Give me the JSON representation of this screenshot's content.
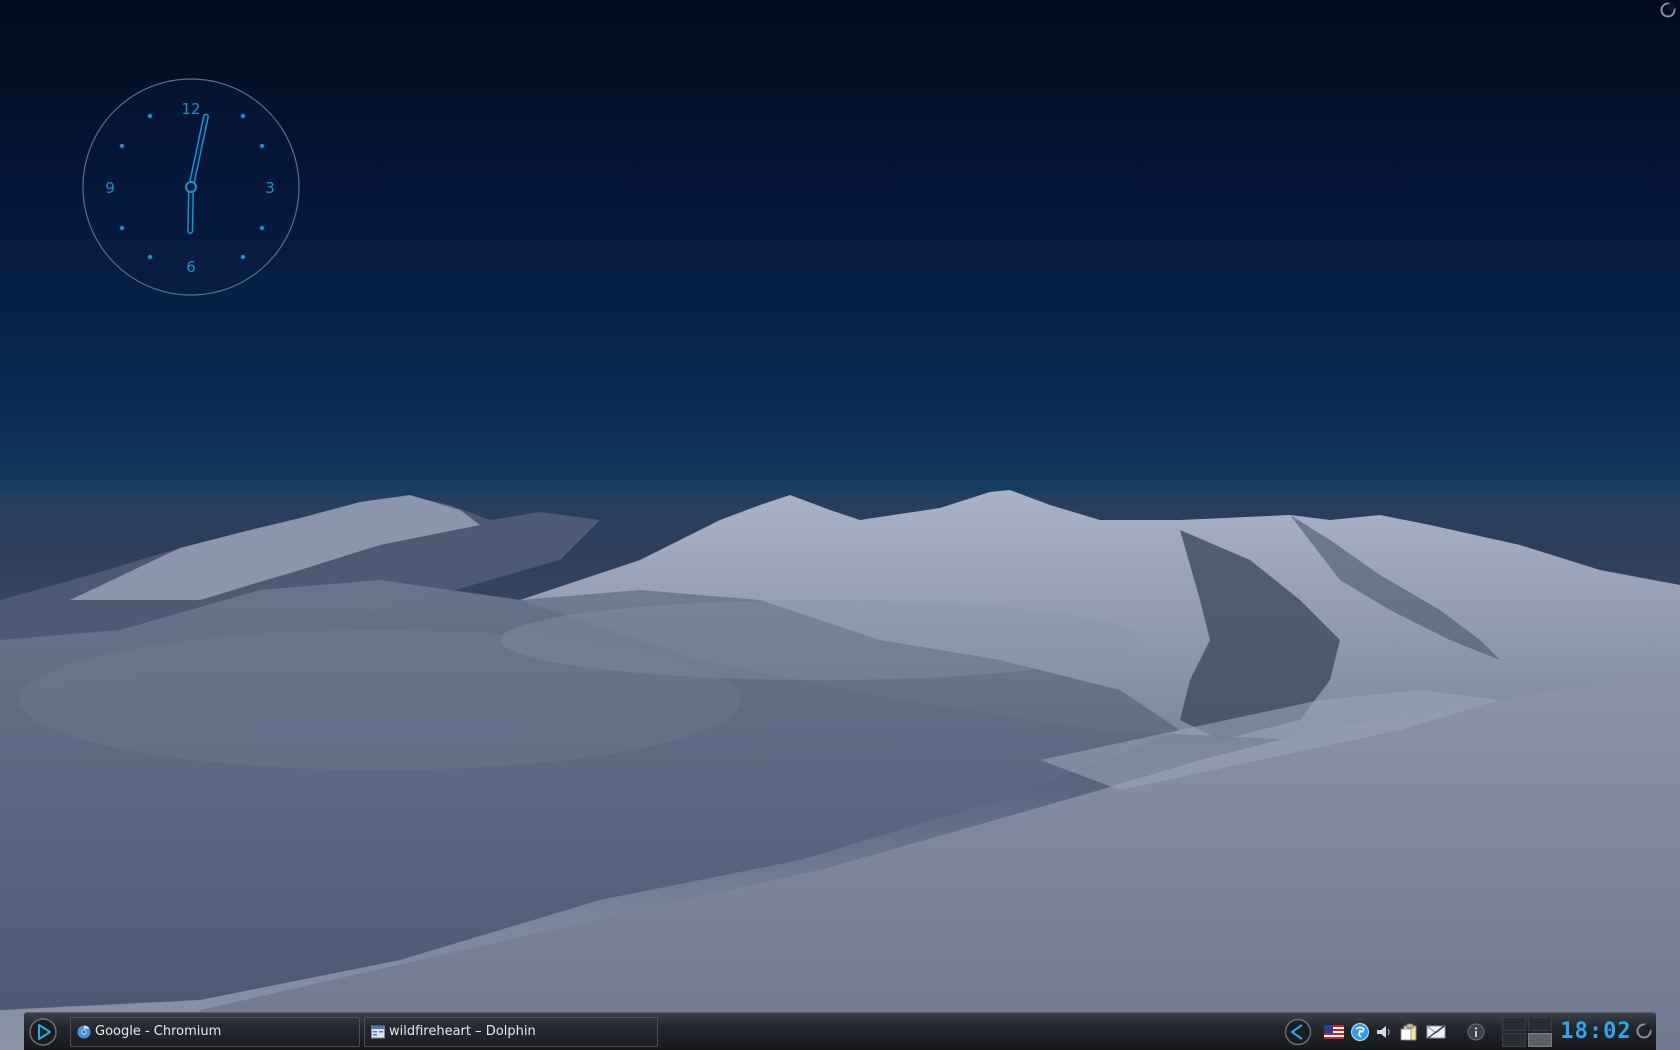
{
  "analog_clock": {
    "numerals": {
      "twelve": "12",
      "three": "3",
      "six": "6",
      "nine": "9"
    },
    "time": "18:02",
    "accent_color": "#1e8fd0"
  },
  "taskbar": {
    "launcher_icon": "kickoff-launcher-icon",
    "tasks": [
      {
        "label": "Google - Chromium",
        "icon": "chromium-icon"
      },
      {
        "label": "wildfireheart – Dolphin",
        "icon": "dolphin-icon"
      }
    ],
    "tray_icons": [
      "tray-expand-icon",
      "us-flag-keyboard-icon",
      "network-manager-icon",
      "volume-icon",
      "clipboard-icon",
      "mail-icon",
      "info-icon"
    ],
    "pager": {
      "desktops": 4,
      "active": 4
    },
    "clock": {
      "time": "18:02",
      "color": "#2aa8e8"
    }
  },
  "colors": {
    "panel_bg": "#1b1d22",
    "clock_blue": "#2aa8e8"
  }
}
